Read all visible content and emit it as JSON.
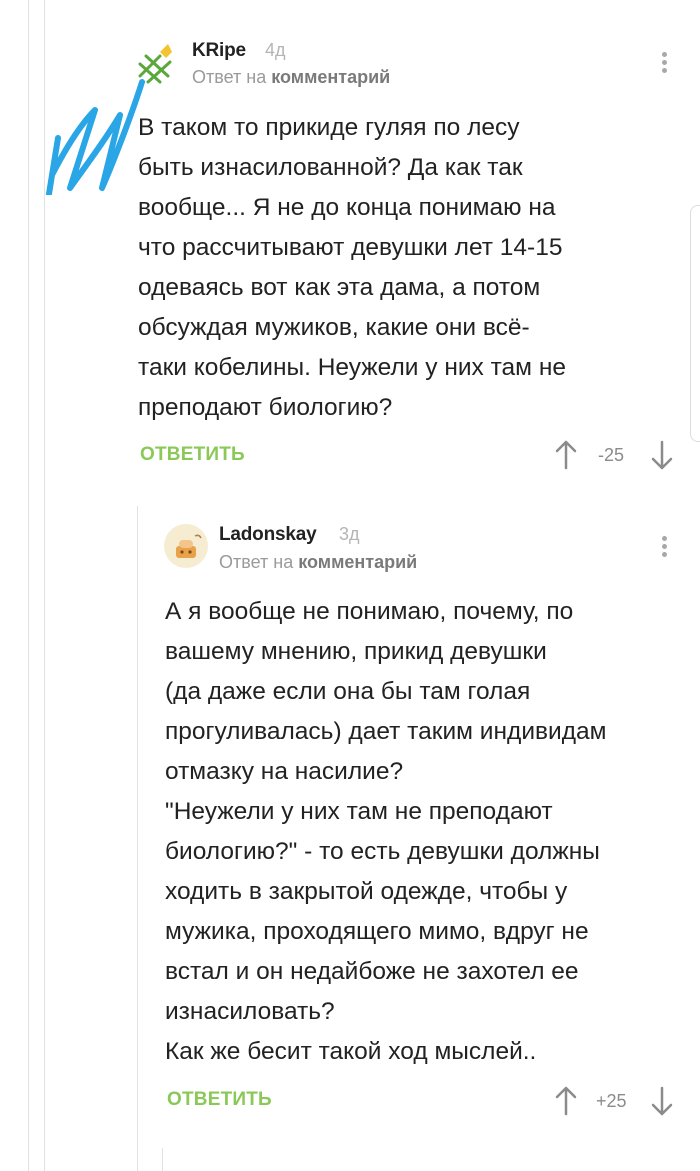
{
  "comments": [
    {
      "author": "KRipe",
      "age": "4д",
      "reply_prefix": "Ответ на",
      "reply_target": "комментарий",
      "text": "В таком то прикиде гуляя по лесу\nбыть изнасилованной? Да как так\nвообще... Я не до конца понимаю на\nчто рассчитывают девушки лет 14-15\nодеваясь вот как эта дама, а потом\nобсуждая мужиков, какие они всё-\nтаки кобелины. Неужели у них там не\nпреподают биологию?",
      "reply_label": "ОТВЕТИТЬ",
      "rating": "-25"
    },
    {
      "author": "Ladonskay",
      "age": "3д",
      "reply_prefix": "Ответ на",
      "reply_target": "комментарий",
      "text": "А я вообще не понимаю, почему, по\nвашему мнению, прикид девушки\n(да даже если она бы там голая\nпрогуливалась) дает таким индивидам\nотмазку на насилие?\n\"Неужели у них там не преподают\nбиологию?\" - то есть девушки должны\nходить в закрытой одежде, чтобы у\nмужика, проходящего мимо, вдруг не\nвстал и он недайбоже не захотел ее\nизнасиловать?\nКак же бесит такой ход мыслей..",
      "reply_label": "ОТВЕТИТЬ",
      "rating": "+25"
    }
  ],
  "colors": {
    "accent_green": "#8ac858",
    "annotation_blue": "#2aa6e6",
    "muted_text": "#9a9a9a"
  },
  "icons": {
    "upvote": "arrow-up-icon",
    "downvote": "arrow-down-icon",
    "menu": "more-vertical-icon"
  }
}
